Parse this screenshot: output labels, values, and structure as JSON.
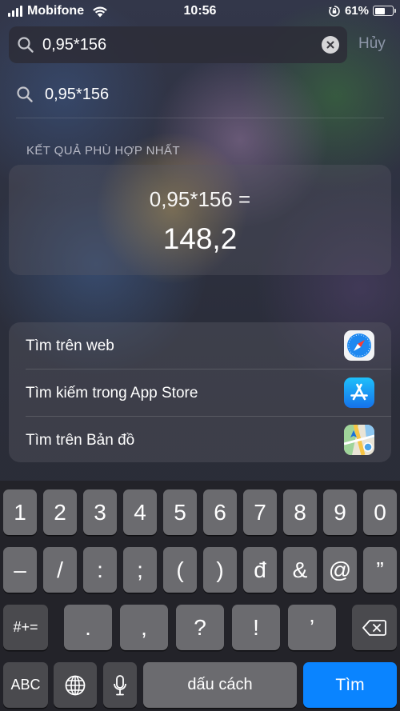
{
  "status_bar": {
    "carrier": "Mobifone",
    "time": "10:56",
    "battery_percent": "61%",
    "battery_level": 0.61
  },
  "search": {
    "query": "0,95*156",
    "cancel_label": "Hủy"
  },
  "suggestion": {
    "text": "0,95*156"
  },
  "top_hit": {
    "section_title": "KẾT QUẢ PHÙ HỢP NHẤT",
    "expression": "0,95*156 =",
    "result": "148,2"
  },
  "actions": [
    {
      "label": "Tìm trên web",
      "icon": "safari-icon"
    },
    {
      "label": "Tìm kiếm trong App Store",
      "icon": "app-store-icon"
    },
    {
      "label": "Tìm trên Bản đồ",
      "icon": "maps-icon"
    }
  ],
  "keyboard": {
    "row1": [
      "1",
      "2",
      "3",
      "4",
      "5",
      "6",
      "7",
      "8",
      "9",
      "0"
    ],
    "row2": [
      "–",
      "/",
      ":",
      ";",
      "(",
      ")",
      "đ",
      "&",
      "@",
      "”"
    ],
    "row3": {
      "shift_label": "#+=",
      "keys": [
        ".",
        ",",
        "?",
        "!",
        "’"
      ]
    },
    "row4": {
      "abc_label": "ABC",
      "space_label": "dấu cách",
      "return_label": "Tìm"
    }
  },
  "colors": {
    "accent_blue": "#0a84ff",
    "key": "#6b6b6f",
    "function_key": "#4a4a4e",
    "cancel_text": "#8d96a8"
  }
}
